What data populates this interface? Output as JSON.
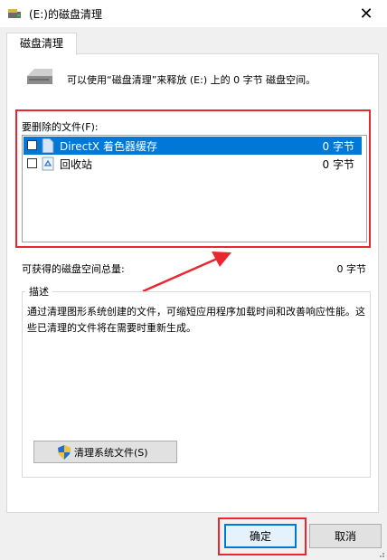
{
  "window": {
    "title": "(E:)的磁盘清理",
    "close_glyph": "✕"
  },
  "tabs": [
    {
      "label": "磁盘清理"
    }
  ],
  "intro_text": "可以使用“磁盘清理”来释放  (E:) 上的 0 字节 磁盘空间。",
  "files_to_delete": {
    "label": "要删除的文件(F):",
    "items": [
      {
        "name": "DirectX 着色器缓存",
        "size": "0 字节",
        "checked": false,
        "selected": true,
        "icon": "file-icon"
      },
      {
        "name": "回收站",
        "size": "0 字节",
        "checked": false,
        "selected": false,
        "icon": "recycle-bin-icon"
      }
    ]
  },
  "space_gained": {
    "label": "可获得的磁盘空间总量:",
    "value": "0 字节"
  },
  "description": {
    "title": "描述",
    "text": "通过清理图形系统创建的文件，可缩短应用程序加载时间和改善响应性能。这些已清理的文件将在需要时重新生成。"
  },
  "buttons": {
    "cleanup_system_files": "清理系统文件(S)",
    "ok": "确定",
    "cancel": "取消"
  },
  "colors": {
    "selection": "#0078d7",
    "annotation_red": "#e8282e"
  }
}
